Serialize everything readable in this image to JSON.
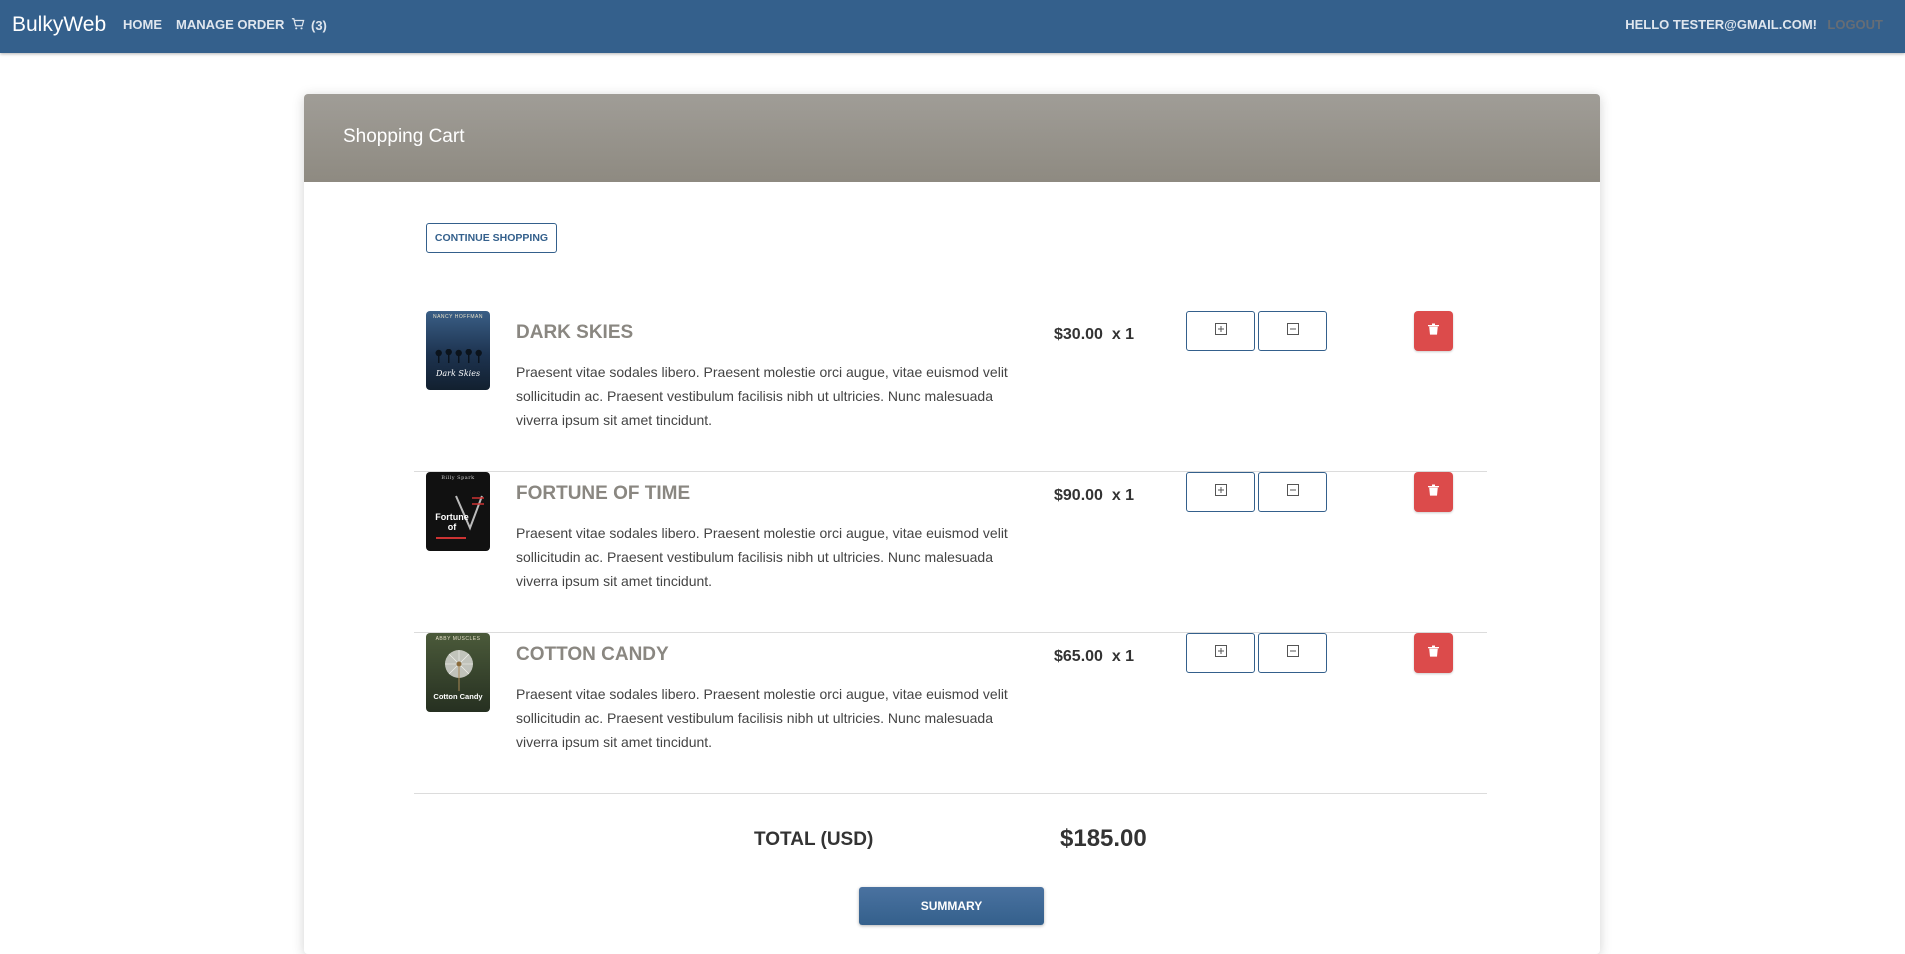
{
  "nav": {
    "brand": "BulkyWeb",
    "home": "HOME",
    "manage_order": "MANAGE ORDER",
    "cart_count": "(3)",
    "hello": "HELLO TESTER@GMAIL.COM!",
    "logout": "LOGOUT"
  },
  "cart": {
    "title": "Shopping Cart",
    "continue_label": "CONTINUE SHOPPING",
    "items": [
      {
        "title": "DARK SKIES",
        "cover_author": "NANCY HOFFMAN",
        "cover_title": "Dark Skies",
        "description": "Praesent vitae sodales libero. Praesent molestie orci augue, vitae euismod velit sollicitudin ac. Praesent vestibulum facilisis nibh ut ultricies. Nunc malesuada viverra ipsum sit amet tincidunt.",
        "price": "$30.00",
        "qty": "x 1"
      },
      {
        "title": "FORTUNE OF TIME",
        "cover_author": "Billy Spark",
        "cover_title": "Fortune of",
        "description": "Praesent vitae sodales libero. Praesent molestie orci augue, vitae euismod velit sollicitudin ac. Praesent vestibulum facilisis nibh ut ultricies. Nunc malesuada viverra ipsum sit amet tincidunt.",
        "price": "$90.00",
        "qty": "x 1"
      },
      {
        "title": "COTTON CANDY",
        "cover_author": "ABBY MUSCLES",
        "cover_title": "Cotton Candy",
        "description": "Praesent vitae sodales libero. Praesent molestie orci augue, vitae euismod velit sollicitudin ac. Praesent vestibulum facilisis nibh ut ultricies. Nunc malesuada viverra ipsum sit amet tincidunt.",
        "price": "$65.00",
        "qty": "x 1"
      }
    ],
    "total_label": "TOTAL (USD)",
    "total_value": "$185.00",
    "summary_label": "SUMMARY"
  },
  "icons": {
    "cart": "cart-icon",
    "plus": "plus-square-icon",
    "minus": "minus-square-icon",
    "delete": "trash-icon"
  },
  "colors": {
    "navbar": "#34608c",
    "header": "#9a968f",
    "delete": "#dc4b4b",
    "title": "#8a8781"
  }
}
